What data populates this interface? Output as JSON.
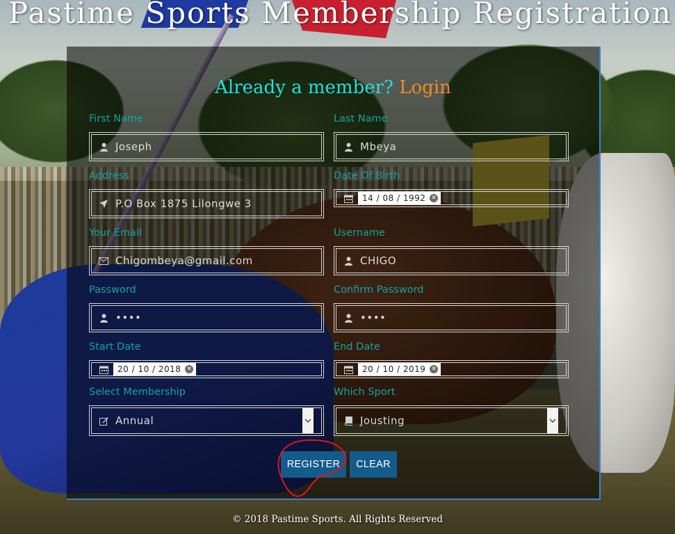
{
  "page": {
    "title": "Pastime Sports Membership Registration",
    "footer": "© 2018 Pastime Sports. All Rights Reserved"
  },
  "header": {
    "prompt": "Already a member?",
    "login_link": "Login"
  },
  "form": {
    "first_name": {
      "label": "First Name",
      "value": "Joseph",
      "icon": "user-icon"
    },
    "last_name": {
      "label": "Last Name",
      "value": "Mbeya",
      "icon": "user-icon"
    },
    "address": {
      "label": "Address",
      "value": "P.O Box 1875 Lilongwe 3",
      "icon": "location-arrow-icon"
    },
    "date_of_birth": {
      "label": "Date Of Birth",
      "value": "14 / 08 / 1992",
      "icon": "calendar-icon"
    },
    "email": {
      "label": "Your Email",
      "value": "Chigombeya@gmail.com",
      "icon": "envelope-icon"
    },
    "username": {
      "label": "Username",
      "value": "CHIGO",
      "icon": "user-icon"
    },
    "password": {
      "label": "Password",
      "value": "••••",
      "icon": "user-icon"
    },
    "confirm_password": {
      "label": "Confirm Password",
      "value": "••••",
      "icon": "user-icon"
    },
    "start_date": {
      "label": "Start Date",
      "value": "20 / 10 / 2018",
      "icon": "calendar-icon"
    },
    "end_date": {
      "label": "End Date",
      "value": "20 / 10 / 2019",
      "icon": "calendar-icon"
    },
    "membership": {
      "label": "Select Membership",
      "value": "Annual",
      "icon": "edit-icon"
    },
    "sport": {
      "label": "Which Sport",
      "value": "Jousting",
      "icon": "book-icon"
    }
  },
  "actions": {
    "register": "REGISTER",
    "clear": "CLEAR"
  },
  "colors": {
    "label": "#12a3a3",
    "prompt": "#20e0e0",
    "login": "#f08a24",
    "button": "#145a8a",
    "panel_border": "#3a84d0",
    "annotation": "#e0141e"
  }
}
